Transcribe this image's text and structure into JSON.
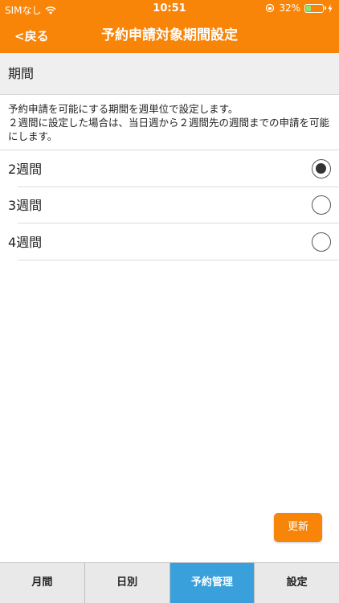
{
  "status_bar": {
    "carrier": "SIMなし",
    "time": "10:51",
    "battery_percent": "32%",
    "battery_level": 0.32
  },
  "nav": {
    "back_label": "<戻る",
    "title": "予約申請対象期間設定"
  },
  "section": {
    "title": "期間",
    "description_line1": "予約申請を可能にする期間を週単位で設定します。",
    "description_line2": "２週間に設定した場合は、当日週から２週間先の週間までの申請を可能にします。"
  },
  "options": [
    {
      "label": "2週間",
      "selected": true
    },
    {
      "label": "3週間",
      "selected": false
    },
    {
      "label": "4週間",
      "selected": false
    }
  ],
  "update_button_label": "更新",
  "tabs": [
    {
      "label": "月間",
      "active": false
    },
    {
      "label": "日別",
      "active": false
    },
    {
      "label": "予約管理",
      "active": true
    },
    {
      "label": "設定",
      "active": false
    }
  ],
  "colors": {
    "accent": "#f88408",
    "tab_active": "#3aa0db",
    "battery_fill": "#8fe26b"
  }
}
